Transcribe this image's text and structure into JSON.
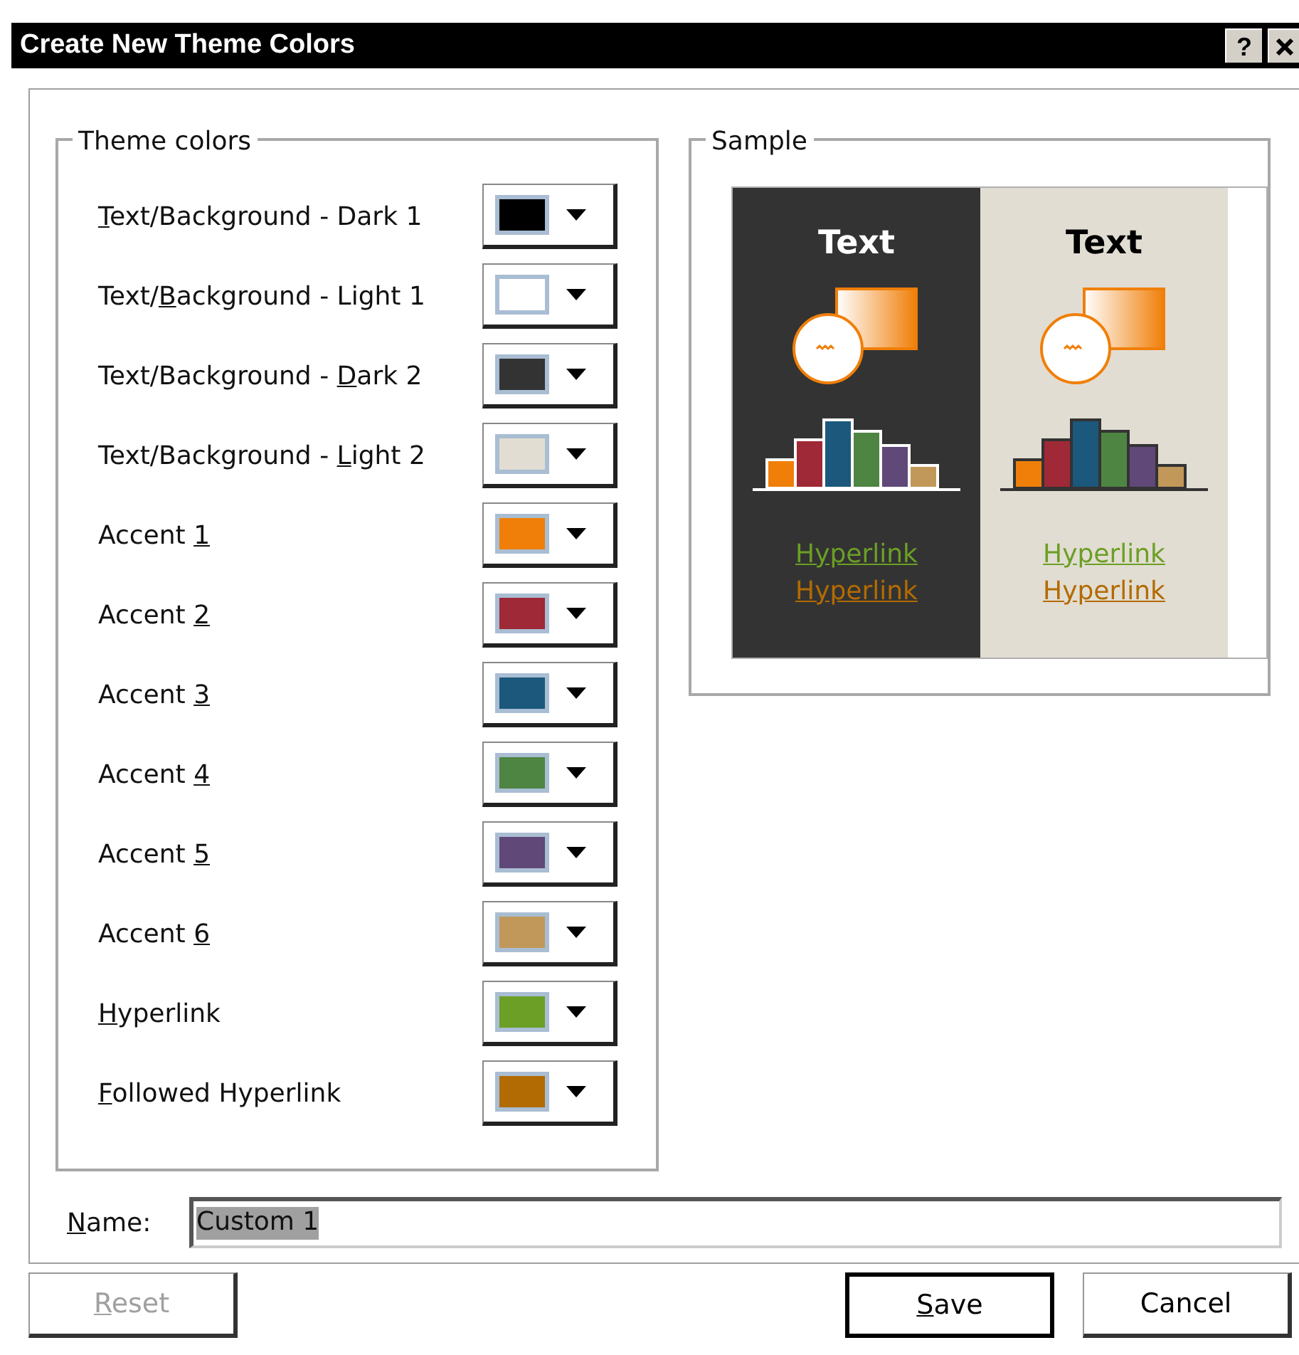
{
  "window": {
    "title": "Create New Theme Colors",
    "help_button": "?"
  },
  "theme_colors": {
    "title": "Theme colors",
    "rows": [
      {
        "access_key": "T",
        "label_after": "ext/Background - Dark 1",
        "color": "#000000"
      },
      {
        "label_before": "Text/",
        "access_key": "B",
        "label_after": "ackground - Light 1",
        "color": "#ffffff"
      },
      {
        "label_before": "Text/Background - ",
        "access_key": "D",
        "label_after": "ark 2",
        "color": "#333333"
      },
      {
        "label_before": "Text/Background - ",
        "access_key": "L",
        "label_after": "ight 2",
        "color": "#e2ddd2"
      },
      {
        "label_before": "Accent ",
        "access_key": "1",
        "color": "#f07f09"
      },
      {
        "label_before": "Accent ",
        "access_key": "2",
        "color": "#9f2936"
      },
      {
        "label_before": "Accent ",
        "access_key": "3",
        "color": "#1b587c"
      },
      {
        "label_before": "Accent ",
        "access_key": "4",
        "color": "#4e8542"
      },
      {
        "label_before": "Accent ",
        "access_key": "5",
        "color": "#604878"
      },
      {
        "label_before": "Accent ",
        "access_key": "6",
        "color": "#c19859"
      },
      {
        "access_key": "H",
        "label_after": "yperlink",
        "color": "#6b9f25"
      },
      {
        "access_key": "F",
        "label_after": "ollowed Hyperlink",
        "color": "#b26b02"
      }
    ]
  },
  "sample": {
    "title": "Sample",
    "panels": [
      {
        "heading": "Text",
        "links": [
          "Hyperlink",
          "Hyperlink"
        ]
      },
      {
        "heading": "Text",
        "links": [
          "Hyperlink",
          "Hyperlink"
        ]
      }
    ]
  },
  "name_field": {
    "access_key": "N",
    "label_after": "ame:",
    "value": "Custom 1",
    "text_selected": true
  },
  "buttons": [
    {
      "access_key": "R",
      "label_after": "eset",
      "disabled": true,
      "default": false
    },
    {
      "access_key": "S",
      "label_after": "ave",
      "disabled": false,
      "default": true
    },
    {
      "label_before": "Cancel",
      "disabled": false,
      "default": false
    }
  ]
}
